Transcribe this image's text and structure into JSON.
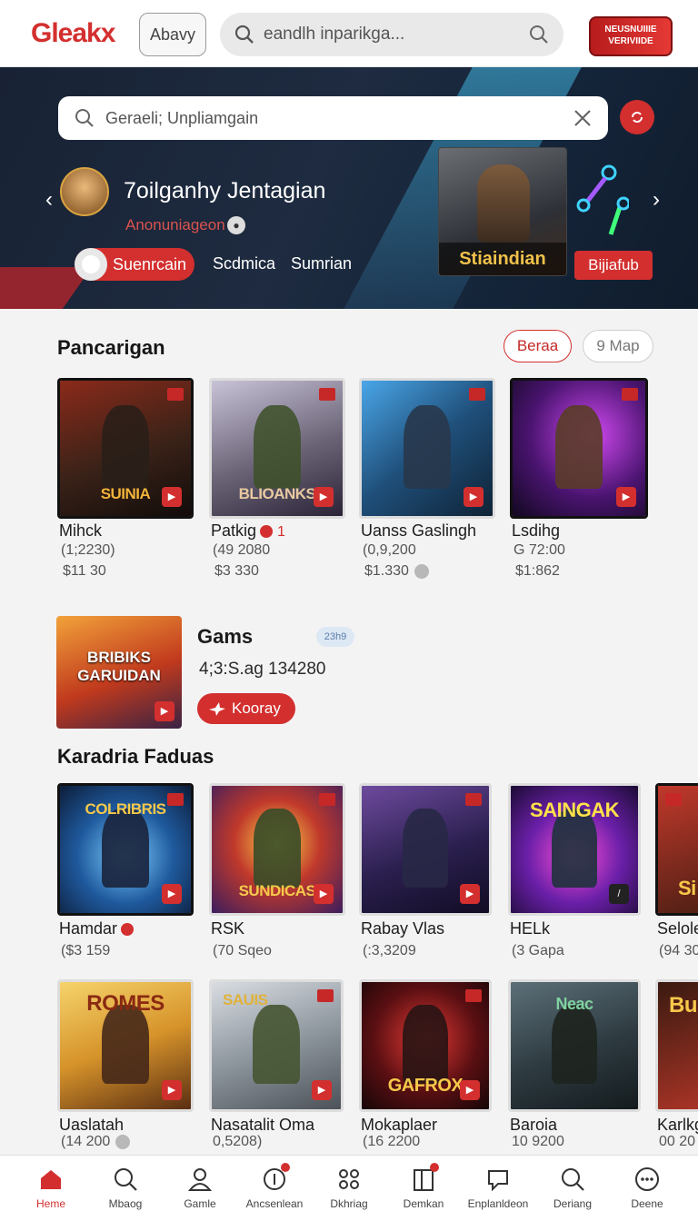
{
  "header": {
    "logo": "Gleakx",
    "away_button": "Abavy",
    "search_placeholder": "eandlh inparikga...",
    "promo_badge": "NEUSNUIIIE VERIVIIDE"
  },
  "hero": {
    "search_value": "Geraeli; Unpliamgain",
    "title": "7oilganhy Jentagian",
    "subtitle": "Anonuniageon",
    "pills": {
      "active": "Suenrcain",
      "second": "Scdmica",
      "third": "Sumrian"
    },
    "card_caption": "Stiaindian",
    "card_button": "Bijiafub"
  },
  "section1": {
    "title": "Pancarigan",
    "chip_primary": "Beraa",
    "chip_secondary": "9 Map",
    "cards": [
      {
        "caption": "SUINIA",
        "name": "Mihck",
        "sub": "(1;2230)",
        "price": "$11 30"
      },
      {
        "caption": "BLIOANKS",
        "name": "Patkig",
        "badge_count": "1",
        "sub": "(49 2080",
        "price": "$3 330"
      },
      {
        "caption": "",
        "name": "Uanss Gaslingh",
        "sub": "(0,9,200",
        "price": "$1.330"
      },
      {
        "caption": "",
        "name": "Lsdihg",
        "sub": "G 72:00",
        "price": "$1:862"
      }
    ]
  },
  "feature": {
    "caption": "BRIBIKS GARUIDAN",
    "title": "Gams",
    "tag": "23h9",
    "value": "4;3:S.ag 134280",
    "button": "Kooray"
  },
  "section2": {
    "title": "Karadria Faduas",
    "row1": [
      {
        "caption": "COLRIBRIS",
        "name": "Hamdar",
        "sub": "($3 159"
      },
      {
        "caption": "SUNDICAS",
        "name": "RSK",
        "sub": "(70 Sqeo"
      },
      {
        "caption": "",
        "name": "Rabay Vlas",
        "sub": "(:3,3209"
      },
      {
        "caption": "SAINGAK",
        "name": "HELk",
        "sub": "(3 Gapa"
      },
      {
        "caption": "Si",
        "name": "Selole",
        "sub": "(94 30"
      }
    ],
    "row2": [
      {
        "caption": "ROMES",
        "name": "Uaslatah",
        "sub": "(14 200"
      },
      {
        "caption": "SAUIS",
        "name": "Nasatalit Oma",
        "sub": "0,5208)"
      },
      {
        "caption": "GAFROX",
        "name": "Mokaplaer",
        "sub": "(16 2200"
      },
      {
        "caption": "Neac",
        "name": "Baroia",
        "sub": "10 9200"
      },
      {
        "caption": "Bu",
        "name": "Karlkg",
        "sub": "00 20"
      }
    ]
  },
  "bottom_nav": [
    {
      "label": "Heme",
      "icon": "home-icon"
    },
    {
      "label": "Mbaog",
      "icon": "search-icon"
    },
    {
      "label": "Gamle",
      "icon": "profile-icon"
    },
    {
      "label": "Ancsenlean",
      "icon": "target-icon"
    },
    {
      "label": "Dkhriag",
      "icon": "grid-icon"
    },
    {
      "label": "Demkan",
      "icon": "book-icon"
    },
    {
      "label": "Enplanldeon",
      "icon": "chat-icon"
    },
    {
      "label": "Deriang",
      "icon": "search-icon"
    },
    {
      "label": "Deene",
      "icon": "more-icon"
    }
  ],
  "colors": {
    "accent": "#d32f2f",
    "hero_bg": "#1e2b40",
    "page_bg": "#f4f3f3"
  }
}
